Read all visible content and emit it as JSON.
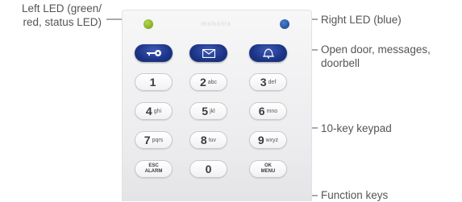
{
  "callouts": {
    "left_led": [
      "Left LED (green/",
      "red, status LED)"
    ],
    "right_led": "Right LED (blue)",
    "function_top": [
      "Open door, messages,",
      "doorbell"
    ],
    "keypad": "10-key keypad",
    "function_keys": "Function keys"
  },
  "keypad": {
    "top_row": [
      {
        "icon": "key-icon"
      },
      {
        "icon": "envelope-icon"
      },
      {
        "icon": "bell-icon"
      }
    ],
    "keys": [
      {
        "digit": "1",
        "letters": ""
      },
      {
        "digit": "2",
        "letters": "abc"
      },
      {
        "digit": "3",
        "letters": "def"
      },
      {
        "digit": "4",
        "letters": "ghi"
      },
      {
        "digit": "5",
        "letters": "jkl"
      },
      {
        "digit": "6",
        "letters": "mno"
      },
      {
        "digit": "7",
        "letters": "pqrs"
      },
      {
        "digit": "8",
        "letters": "tuv"
      },
      {
        "digit": "9",
        "letters": "wxyz"
      }
    ],
    "bottom": {
      "esc": [
        "ESC",
        "ALARM"
      ],
      "zero": "0",
      "ok": [
        "OK",
        "MENU"
      ]
    }
  },
  "colors": {
    "led_left": "#8dbb2a",
    "led_right": "#1d56a8",
    "function_key": "#1c3486",
    "callout_line": "#555555"
  }
}
